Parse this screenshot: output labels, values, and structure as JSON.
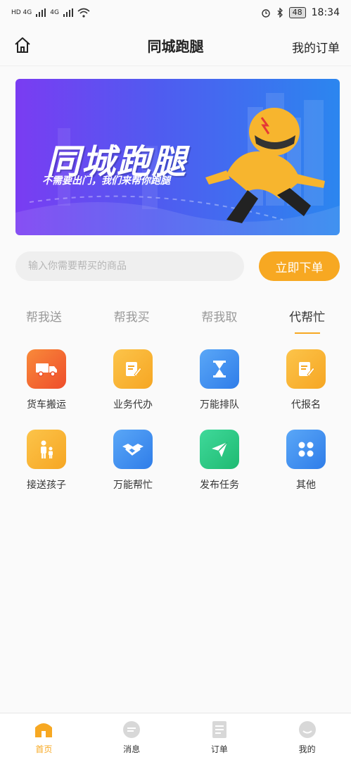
{
  "status_bar": {
    "network_left": "HD 4G",
    "network_right": "4G",
    "battery": "48",
    "time": "18:34"
  },
  "header": {
    "title": "同城跑腿",
    "orders_link": "我的订单"
  },
  "banner": {
    "title": "同城跑腿",
    "subtitle": "不需要出门，我们来帮你跑腿"
  },
  "search": {
    "placeholder": "输入你需要帮买的商品",
    "value": "",
    "button": "立即下单"
  },
  "tabs": [
    "帮我送",
    "帮我买",
    "帮我取",
    "代帮忙"
  ],
  "active_tab": 3,
  "services": [
    {
      "label": "货车搬运",
      "icon": "truck-icon",
      "color": "#f0642d"
    },
    {
      "label": "业务代办",
      "icon": "edit-doc-icon",
      "color": "#f7b52e"
    },
    {
      "label": "万能排队",
      "icon": "hourglass-icon",
      "color": "#3f8ef2"
    },
    {
      "label": "代报名",
      "icon": "signup-doc-icon",
      "color": "#f7b52e"
    },
    {
      "label": "接送孩子",
      "icon": "parent-child-icon",
      "color": "#f7b52e"
    },
    {
      "label": "万能帮忙",
      "icon": "handshake-icon",
      "color": "#3f8ef2"
    },
    {
      "label": "发布任务",
      "icon": "send-icon",
      "color": "#2ecb84"
    },
    {
      "label": "其他",
      "icon": "grid-dots-icon",
      "color": "#3f8ef2"
    }
  ],
  "bottom_nav": [
    "首页",
    "消息",
    "订单",
    "我的"
  ]
}
